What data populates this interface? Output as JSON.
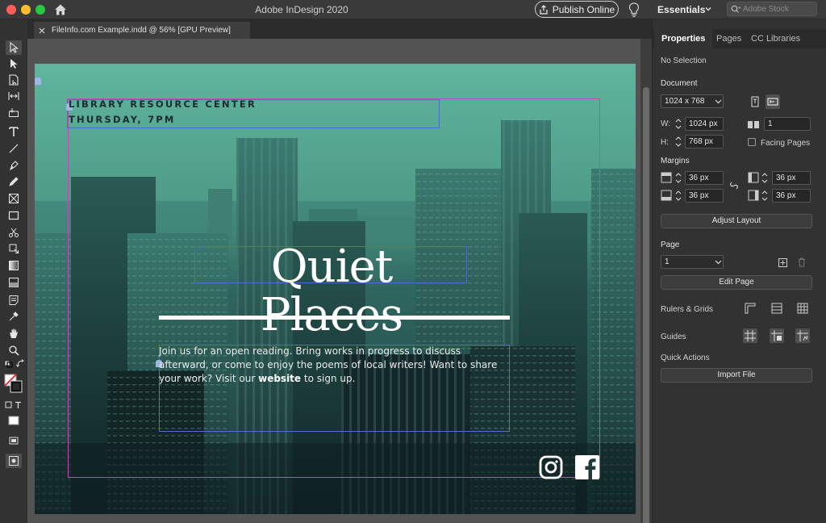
{
  "app": {
    "title": "Adobe InDesign 2020",
    "publish_label": "Publish Online",
    "workspace": "Essentials",
    "stock_placeholder": "Adobe Stock"
  },
  "tab": {
    "label": "FileInfo.com Example.indd @ 56% [GPU Preview]"
  },
  "page": {
    "eyebrow_line1": "LIBRARY RESOURCE CENTER",
    "eyebrow_line2": "THURSDAY, 7PM",
    "headline": "Quiet Places",
    "body_before": "Join us for an open reading. Bring works in progress to discuss afterward, or come to enjoy the poems of local writers! Want to share your work? Visit our ",
    "body_link": "website",
    "body_after": " to sign up."
  },
  "panel": {
    "tabs": [
      "Properties",
      "Pages",
      "CC Libraries"
    ],
    "selection": "No Selection",
    "document_heading": "Document",
    "preset": "1024 x 768",
    "w_label": "W:",
    "width": "1024 px",
    "h_label": "H:",
    "height": "768 px",
    "pages_count": "1",
    "facing_pages_label": "Facing Pages",
    "margins_heading": "Margins",
    "margin_top": "36 px",
    "margin_bottom": "36 px",
    "margin_inside": "36 px",
    "margin_outside": "36 px",
    "adjust_layout": "Adjust Layout",
    "page_heading": "Page",
    "page_number": "1",
    "edit_page": "Edit Page",
    "rulers_grids": "Rulers & Grids",
    "guides": "Guides",
    "quick_actions": "Quick Actions",
    "import_file": "Import File"
  },
  "colors": {
    "accent_teal": "#5fb59d",
    "frame_blue": "#4f6fc6",
    "margin_magenta": "#b64fb8"
  }
}
